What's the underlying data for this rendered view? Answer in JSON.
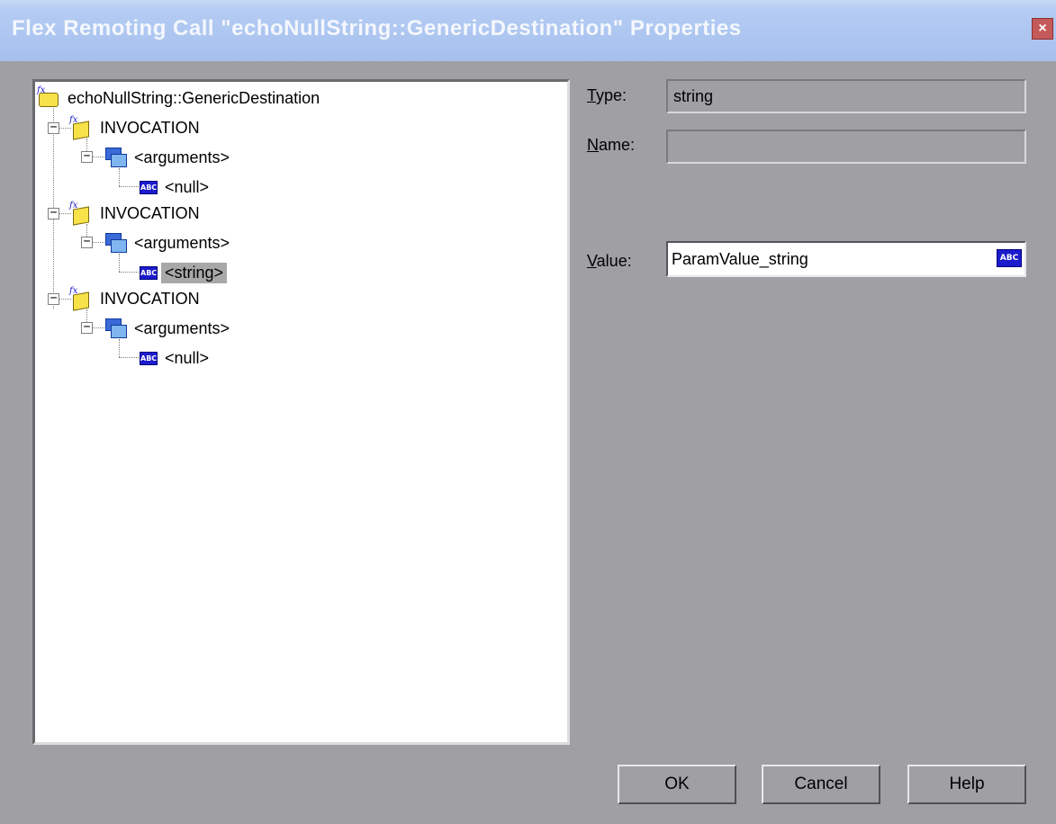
{
  "window": {
    "title": "Flex Remoting Call \"echoNullString::GenericDestination\" Properties",
    "close_glyph": "×"
  },
  "tree": {
    "root_label": "echoNullString::GenericDestination",
    "invocations": [
      {
        "label": "INVOCATION",
        "arguments_label": "<arguments>",
        "value_label": "<null>",
        "selected": false
      },
      {
        "label": "INVOCATION",
        "arguments_label": "<arguments>",
        "value_label": "<string>",
        "selected": true
      },
      {
        "label": "INVOCATION",
        "arguments_label": "<arguments>",
        "value_label": "<null>",
        "selected": false
      }
    ],
    "expander_glyph": "−",
    "abc_icon_text": "ABC"
  },
  "properties": {
    "type_label_mnemonic": "T",
    "type_label_rest": "ype:",
    "type_value": "string",
    "name_label_mnemonic": "N",
    "name_label_rest": "ame:",
    "name_value": "",
    "value_label_mnemonic": "V",
    "value_label_rest": "alue:",
    "value_value": "ParamValue_string",
    "value_type_icon_text": "ABC"
  },
  "buttons": {
    "ok": "OK",
    "cancel": "Cancel",
    "help": "Help"
  },
  "icons": [
    "flex-call-icon",
    "invocation-icon",
    "arguments-icon",
    "abc-type-icon",
    "close-icon"
  ],
  "colors": {
    "dialog_background": "#a0a0a4",
    "titlebar": "#b4ccf3",
    "selection": "#a8a8a8",
    "abc_icon": "#1c1ccc"
  }
}
